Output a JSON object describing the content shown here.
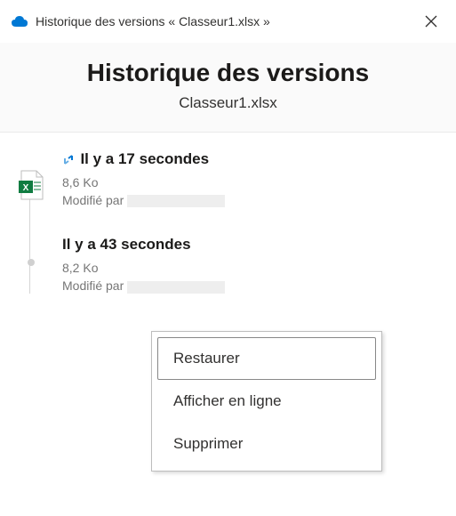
{
  "titlebar": {
    "text": "Historique des versions « Classeur1.xlsx »"
  },
  "header": {
    "title": "Historique des versions",
    "filename": "Classeur1.xlsx"
  },
  "versions": [
    {
      "time": "Il y a 17 secondes",
      "size": "8,6 Ko",
      "modified_label": "Modifié par "
    },
    {
      "time": "Il y a 43 secondes",
      "size": "8,2 Ko",
      "modified_label": "Modifié par "
    }
  ],
  "context_menu": {
    "restore": "Restaurer",
    "view_online": "Afficher en ligne",
    "delete": "Supprimer"
  }
}
